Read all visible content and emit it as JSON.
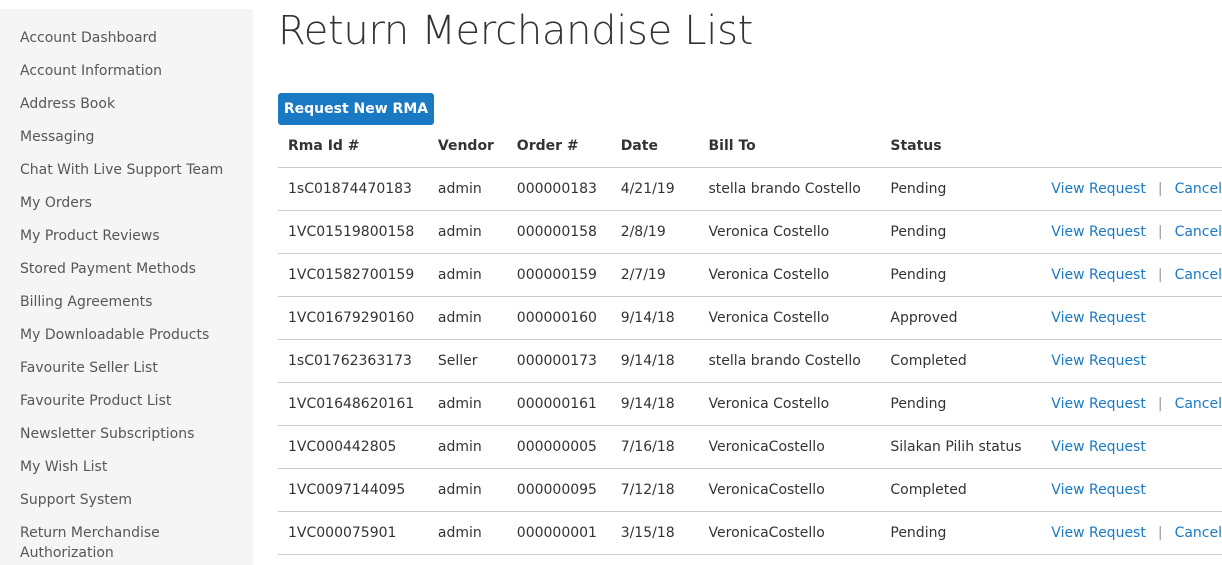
{
  "sidebar": {
    "items": [
      "Account Dashboard",
      "Account Information",
      "Address Book",
      "Messaging",
      "Chat With Live Support Team",
      "My Orders",
      "My Product Reviews",
      "Stored Payment Methods",
      "Billing Agreements",
      "My Downloadable Products",
      "Favourite Seller List",
      "Favourite Product List",
      "Newsletter Subscriptions",
      "My Wish List",
      "Support System",
      "Return Merchandise Authorization"
    ]
  },
  "page": {
    "title": "Return Merchandise List",
    "new_rma_label": "Request New RMA"
  },
  "table": {
    "headers": [
      "Rma Id #",
      "Vendor",
      "Order #",
      "Date",
      "Bill To",
      "Status"
    ],
    "view_label": "View Request",
    "cancel_label": "Cancel",
    "separator": "|",
    "rows": [
      {
        "rma_id": "1sC01874470183",
        "vendor": "admin",
        "order": "000000183",
        "date": "4/21/19",
        "bill_to": "stella brando Costello",
        "status": "Pending",
        "cancel": true
      },
      {
        "rma_id": "1VC01519800158",
        "vendor": "admin",
        "order": "000000158",
        "date": "2/8/19",
        "bill_to": "Veronica Costello",
        "status": "Pending",
        "cancel": true
      },
      {
        "rma_id": "1VC01582700159",
        "vendor": "admin",
        "order": "000000159",
        "date": "2/7/19",
        "bill_to": "Veronica Costello",
        "status": "Pending",
        "cancel": true
      },
      {
        "rma_id": "1VC01679290160",
        "vendor": "admin",
        "order": "000000160",
        "date": "9/14/18",
        "bill_to": "Veronica Costello",
        "status": "Approved",
        "cancel": false
      },
      {
        "rma_id": "1sC01762363173",
        "vendor": "Seller",
        "order": "000000173",
        "date": "9/14/18",
        "bill_to": "stella brando Costello",
        "status": "Completed",
        "cancel": false
      },
      {
        "rma_id": "1VC01648620161",
        "vendor": "admin",
        "order": "000000161",
        "date": "9/14/18",
        "bill_to": "Veronica Costello",
        "status": "Pending",
        "cancel": true
      },
      {
        "rma_id": "1VC000442805",
        "vendor": "admin",
        "order": "000000005",
        "date": "7/16/18",
        "bill_to": "VeronicaCostello",
        "status": "Silakan Pilih status",
        "cancel": false
      },
      {
        "rma_id": "1VC0097144095",
        "vendor": "admin",
        "order": "000000095",
        "date": "7/12/18",
        "bill_to": "VeronicaCostello",
        "status": "Completed",
        "cancel": false
      },
      {
        "rma_id": "1VC000075901",
        "vendor": "admin",
        "order": "000000001",
        "date": "3/15/18",
        "bill_to": "VeronicaCostello",
        "status": "Pending",
        "cancel": true
      }
    ]
  },
  "colors": {
    "link": "#1979c3",
    "button": "#1979c3",
    "sidebar_bg": "#f5f5f5",
    "border": "#cccccc"
  }
}
